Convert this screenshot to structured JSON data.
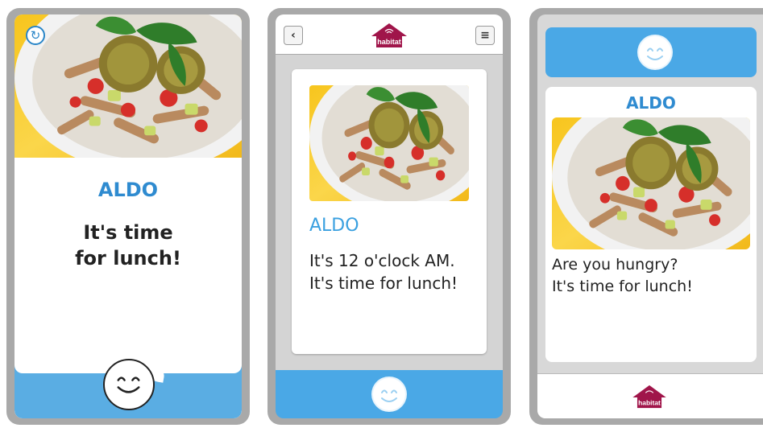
{
  "colors": {
    "accent_blue": "#2f8bd0",
    "bar_blue": "#4aa8e6",
    "brand_magenta": "#a0154a",
    "frame_gray": "#a9a9a9"
  },
  "screen1": {
    "name": "ALDO",
    "message_lines": [
      "It's time",
      "for lunch!"
    ],
    "reload_icon": "refresh-icon",
    "avatar_icon": "smiley-icon"
  },
  "screen2": {
    "back_icon": "chevron-left-icon",
    "back_label": "‹",
    "menu_icon": "hamburger-menu-icon",
    "menu_label": "≡",
    "logo_text": "habitat",
    "name": "ALDO",
    "message_lines": [
      "It's 12 o'clock AM.",
      "It's time for lunch!"
    ],
    "bottom_icon": "smiley-icon"
  },
  "screen3": {
    "top_icon": "smiley-icon",
    "name": "ALDO",
    "message_lines": [
      "Are you hungry?",
      "It's time for lunch!"
    ],
    "logo_text": "habitat"
  }
}
